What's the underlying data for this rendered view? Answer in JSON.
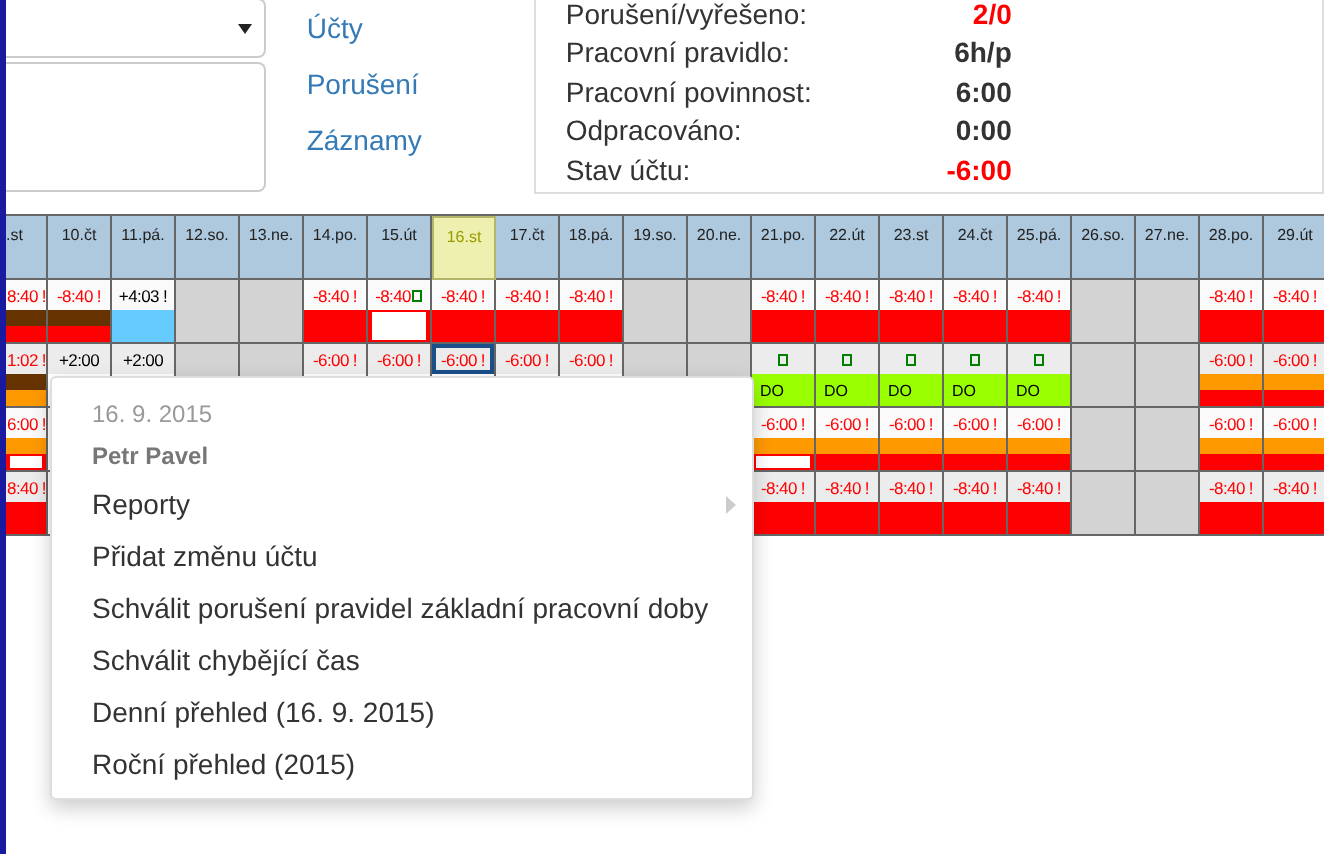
{
  "links": [
    {
      "label": "Účty"
    },
    {
      "label": "Porušení"
    },
    {
      "label": "Záznamy"
    }
  ],
  "summary": [
    {
      "label": "Porušení/vyřešeno:",
      "value": "2/0",
      "negative": true
    },
    {
      "label": "Pracovní pravidlo:",
      "value": "6h/p",
      "negative": false
    },
    {
      "label": "Pracovní povinnost:",
      "value": "6:00",
      "negative": false
    },
    {
      "label": "Odpracováno:",
      "value": "0:00",
      "negative": false
    },
    {
      "label": "Stav účtu:",
      "value": "-6:00",
      "negative": true
    }
  ],
  "columns": [
    {
      "label": ".st",
      "selected": false
    },
    {
      "label": "10.čt",
      "selected": false
    },
    {
      "label": "11.pá.",
      "selected": false
    },
    {
      "label": "12.so.",
      "selected": false
    },
    {
      "label": "13.ne.",
      "selected": false
    },
    {
      "label": "14.po.",
      "selected": false
    },
    {
      "label": "15.út",
      "selected": false
    },
    {
      "label": "16.st",
      "selected": true
    },
    {
      "label": "17.čt",
      "selected": false
    },
    {
      "label": "18.pá.",
      "selected": false
    },
    {
      "label": "19.so.",
      "selected": false
    },
    {
      "label": "20.ne.",
      "selected": false
    },
    {
      "label": "21.po.",
      "selected": false
    },
    {
      "label": "22.út",
      "selected": false
    },
    {
      "label": "23.st",
      "selected": false
    },
    {
      "label": "24.čt",
      "selected": false
    },
    {
      "label": "25.pá.",
      "selected": false
    },
    {
      "label": "26.so.",
      "selected": false
    },
    {
      "label": "27.ne.",
      "selected": false
    },
    {
      "label": "28.po.",
      "selected": false
    },
    {
      "label": "29.út",
      "selected": false
    }
  ],
  "rows": [
    {
      "cells": [
        {
          "kind": "day",
          "text": "8:40 !",
          "negative": true,
          "selected": false,
          "bars": [
            {
              "color": "#663300"
            },
            {
              "color": "#ff0000"
            }
          ]
        },
        {
          "kind": "day",
          "text": "-8:40 !",
          "negative": true,
          "selected": false,
          "bars": [
            {
              "color": "#663300"
            },
            {
              "color": "#ff0000"
            }
          ]
        },
        {
          "kind": "day",
          "text": "+4:03 !",
          "negative": false,
          "selected": false,
          "bars": [
            {
              "color": "#66ccff"
            }
          ]
        },
        {
          "kind": "weekend"
        },
        {
          "kind": "weekend"
        },
        {
          "kind": "day",
          "text": "-8:40 !",
          "negative": true,
          "selected": false,
          "bars": [
            {
              "color": "#ff0000"
            }
          ]
        },
        {
          "kind": "day",
          "text": "-8:40",
          "negative": true,
          "selected": false,
          "square": true,
          "bars": [
            {
              "color": "#ff0000",
              "marker": true
            }
          ]
        },
        {
          "kind": "day",
          "text": "-8:40 !",
          "negative": true,
          "selected": false,
          "bars": [
            {
              "color": "#ff0000"
            }
          ]
        },
        {
          "kind": "day",
          "text": "-8:40 !",
          "negative": true,
          "selected": false,
          "bars": [
            {
              "color": "#ff0000"
            }
          ]
        },
        {
          "kind": "day",
          "text": "-8:40 !",
          "negative": true,
          "selected": false,
          "bars": [
            {
              "color": "#ff0000"
            }
          ]
        },
        {
          "kind": "weekend"
        },
        {
          "kind": "weekend"
        },
        {
          "kind": "day",
          "text": "-8:40 !",
          "negative": true,
          "selected": false,
          "bars": [
            {
              "color": "#ff0000"
            }
          ]
        },
        {
          "kind": "day",
          "text": "-8:40 !",
          "negative": true,
          "selected": false,
          "bars": [
            {
              "color": "#ff0000"
            }
          ]
        },
        {
          "kind": "day",
          "text": "-8:40 !",
          "negative": true,
          "selected": false,
          "bars": [
            {
              "color": "#ff0000"
            }
          ]
        },
        {
          "kind": "day",
          "text": "-8:40 !",
          "negative": true,
          "selected": false,
          "bars": [
            {
              "color": "#ff0000"
            }
          ]
        },
        {
          "kind": "day",
          "text": "-8:40 !",
          "negative": true,
          "selected": false,
          "bars": [
            {
              "color": "#ff0000"
            }
          ]
        },
        {
          "kind": "weekend"
        },
        {
          "kind": "weekend"
        },
        {
          "kind": "day",
          "text": "-8:40 !",
          "negative": true,
          "selected": false,
          "bars": [
            {
              "color": "#ff0000"
            }
          ]
        },
        {
          "kind": "day",
          "text": "-8:40 !",
          "negative": true,
          "selected": false,
          "bars": [
            {
              "color": "#ff0000"
            }
          ]
        }
      ]
    },
    {
      "cells": [
        {
          "kind": "day",
          "text": "1:02 !",
          "negative": true,
          "selected": false,
          "bars": [
            {
              "color": "#663300"
            },
            {
              "color": "#ff9900"
            }
          ]
        },
        {
          "kind": "day",
          "text": "+2:00",
          "negative": false,
          "selected": false
        },
        {
          "kind": "day",
          "text": "+2:00",
          "negative": false,
          "selected": false
        },
        {
          "kind": "weekend"
        },
        {
          "kind": "weekend"
        },
        {
          "kind": "day",
          "text": "-6:00 !",
          "negative": true,
          "selected": false
        },
        {
          "kind": "day",
          "text": "-6:00 !",
          "negative": true,
          "selected": false
        },
        {
          "kind": "day",
          "text": "-6:00 !",
          "negative": true,
          "selected": true
        },
        {
          "kind": "day",
          "text": "-6:00 !",
          "negative": true,
          "selected": false
        },
        {
          "kind": "day",
          "text": "-6:00 !",
          "negative": true,
          "selected": false
        },
        {
          "kind": "weekend"
        },
        {
          "kind": "weekend"
        },
        {
          "kind": "day",
          "selected": false,
          "square": true,
          "bars": [
            {
              "color": "#99ff00",
              "label": "DO"
            }
          ]
        },
        {
          "kind": "day",
          "selected": false,
          "square": true,
          "bars": [
            {
              "color": "#99ff00",
              "label": "DO"
            }
          ]
        },
        {
          "kind": "day",
          "selected": false,
          "square": true,
          "bars": [
            {
              "color": "#99ff00",
              "label": "DO"
            }
          ]
        },
        {
          "kind": "day",
          "selected": false,
          "square": true,
          "bars": [
            {
              "color": "#99ff00",
              "label": "DO"
            }
          ]
        },
        {
          "kind": "day",
          "selected": false,
          "square": true,
          "bars": [
            {
              "color": "#99ff00",
              "label": "DO"
            }
          ]
        },
        {
          "kind": "weekend"
        },
        {
          "kind": "weekend"
        },
        {
          "kind": "day",
          "text": "-6:00 !",
          "negative": true,
          "selected": false,
          "bars": [
            {
              "color": "#ff9900"
            },
            {
              "color": "#ff0000"
            }
          ]
        },
        {
          "kind": "day",
          "text": "-6:00 !",
          "negative": true,
          "selected": false,
          "bars": [
            {
              "color": "#ff9900"
            },
            {
              "color": "#ff0000"
            }
          ]
        }
      ]
    },
    {
      "cells": [
        {
          "kind": "day",
          "text": "6:00 !",
          "negative": true,
          "selected": false,
          "bars": [
            {
              "color": "#ff9900"
            },
            {
              "color": "#ff0000",
              "marker": true
            }
          ]
        },
        {
          "kind": "blank"
        },
        {
          "kind": "blank"
        },
        {
          "kind": "blank"
        },
        {
          "kind": "blank"
        },
        {
          "kind": "blank"
        },
        {
          "kind": "blank"
        },
        {
          "kind": "blank"
        },
        {
          "kind": "blank"
        },
        {
          "kind": "blank"
        },
        {
          "kind": "blank"
        },
        {
          "kind": "blank"
        },
        {
          "kind": "day",
          "text": "-6:00 !",
          "negative": true,
          "selected": false,
          "bars": [
            {
              "color": "#ff9900"
            },
            {
              "color": "#ff0000",
              "marker": true
            }
          ]
        },
        {
          "kind": "day",
          "text": "-6:00 !",
          "negative": true,
          "selected": false,
          "bars": [
            {
              "color": "#ff9900"
            },
            {
              "color": "#ff0000"
            }
          ]
        },
        {
          "kind": "day",
          "text": "-6:00 !",
          "negative": true,
          "selected": false,
          "bars": [
            {
              "color": "#ff9900"
            },
            {
              "color": "#ff0000"
            }
          ]
        },
        {
          "kind": "day",
          "text": "-6:00 !",
          "negative": true,
          "selected": false,
          "bars": [
            {
              "color": "#ff9900"
            },
            {
              "color": "#ff0000"
            }
          ]
        },
        {
          "kind": "day",
          "text": "-6:00 !",
          "negative": true,
          "selected": false,
          "bars": [
            {
              "color": "#ff9900"
            },
            {
              "color": "#ff0000"
            }
          ]
        },
        {
          "kind": "weekend"
        },
        {
          "kind": "weekend"
        },
        {
          "kind": "day",
          "text": "-6:00 !",
          "negative": true,
          "selected": false,
          "bars": [
            {
              "color": "#ff9900"
            },
            {
              "color": "#ff0000"
            }
          ]
        },
        {
          "kind": "day",
          "text": "-6:00 !",
          "negative": true,
          "selected": false,
          "bars": [
            {
              "color": "#ff9900"
            },
            {
              "color": "#ff0000"
            }
          ]
        }
      ]
    },
    {
      "cells": [
        {
          "kind": "day",
          "text": "8:40 !",
          "negative": true,
          "selected": false,
          "bars": [
            {
              "color": "#ff0000"
            }
          ]
        },
        {
          "kind": "blank"
        },
        {
          "kind": "blank"
        },
        {
          "kind": "blank"
        },
        {
          "kind": "blank"
        },
        {
          "kind": "blank"
        },
        {
          "kind": "blank"
        },
        {
          "kind": "blank"
        },
        {
          "kind": "blank"
        },
        {
          "kind": "blank"
        },
        {
          "kind": "blank"
        },
        {
          "kind": "blank"
        },
        {
          "kind": "day",
          "text": "-8:40 !",
          "negative": true,
          "selected": false,
          "bars": [
            {
              "color": "#ff0000"
            }
          ]
        },
        {
          "kind": "day",
          "text": "-8:40 !",
          "negative": true,
          "selected": false,
          "bars": [
            {
              "color": "#ff0000"
            }
          ]
        },
        {
          "kind": "day",
          "text": "-8:40 !",
          "negative": true,
          "selected": false,
          "bars": [
            {
              "color": "#ff0000"
            }
          ]
        },
        {
          "kind": "day",
          "text": "-8:40 !",
          "negative": true,
          "selected": false,
          "bars": [
            {
              "color": "#ff0000"
            }
          ]
        },
        {
          "kind": "day",
          "text": "-8:40 !",
          "negative": true,
          "selected": false,
          "bars": [
            {
              "color": "#ff0000"
            }
          ]
        },
        {
          "kind": "weekend"
        },
        {
          "kind": "weekend"
        },
        {
          "kind": "day",
          "text": "-8:40 !",
          "negative": true,
          "selected": false,
          "bars": [
            {
              "color": "#ff0000"
            }
          ]
        },
        {
          "kind": "day",
          "text": "-8:40 !",
          "negative": true,
          "selected": false,
          "bars": [
            {
              "color": "#ff0000"
            }
          ]
        }
      ]
    }
  ],
  "context_menu": [
    {
      "kind": "date",
      "label": "16. 9. 2015"
    },
    {
      "kind": "name",
      "label": "Petr Pavel"
    },
    {
      "kind": "submenu",
      "label": "Reporty"
    },
    {
      "kind": "action",
      "label": "Přidat změnu účtu"
    },
    {
      "kind": "action",
      "label": "Schválit porušení pravidel základní pracovní doby"
    },
    {
      "kind": "action",
      "label": "Schválit chybějící čas"
    },
    {
      "kind": "action",
      "label": "Denní přehled (16. 9. 2015)"
    },
    {
      "kind": "action",
      "label": "Roční přehled (2015)"
    }
  ]
}
